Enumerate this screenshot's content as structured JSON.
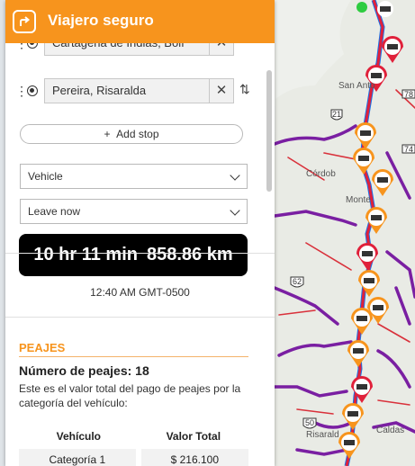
{
  "app": {
    "title": "Viajero seguro",
    "logo_icon": "turn-right-arrow-icon"
  },
  "stops": [
    {
      "value": "Cartagena de Indias, Bolí"
    },
    {
      "value": "Pereira, Risaralda"
    }
  ],
  "add_stop_label": "Add stop",
  "vehicle_select": {
    "value": "Vehicle"
  },
  "depart_select": {
    "value": "Leave now"
  },
  "route_summary": {
    "duration": "10 hr 11 min",
    "distance": "858.86 km"
  },
  "departure_time": "12:40 AM GMT-0500",
  "tolls": {
    "heading": "PEAJES",
    "count_text": "Número de peajes: 18",
    "description": "Este es el valor total del pago de peajes por la categoría del vehículo:",
    "table": {
      "headers": [
        "Vehículo",
        "Valor Total"
      ],
      "rows": [
        {
          "category": "Categoría 1",
          "value": "$ 216.100"
        }
      ]
    }
  },
  "map": {
    "labels": [
      "San Anto",
      "Córdob",
      "Monte",
      "Caldas",
      "Risarald"
    ],
    "route_shields": [
      "21",
      "62",
      "50",
      "74",
      "78"
    ],
    "colors": {
      "route": "#e0203a",
      "highway": "#7a1fa2",
      "toll_marker": "#f7941d",
      "toll_marker_alt": "#e0203a",
      "route_alt": "#1a73e8"
    }
  },
  "colors": {
    "accent": "#f7941d",
    "summary_bg": "#000000"
  }
}
